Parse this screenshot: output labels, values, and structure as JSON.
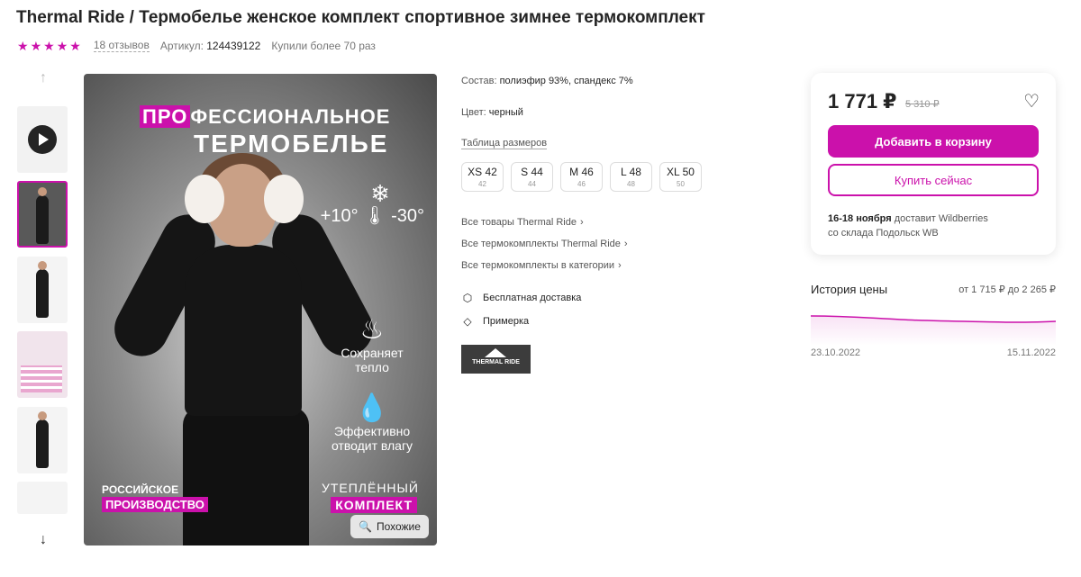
{
  "product": {
    "title": "Thermal Ride / Термобелье женское комплект спортивное зимнее термокомплект",
    "rating_stars": 5,
    "reviews": "18 отзывов",
    "article_label": "Артикул:",
    "article_value": "124439122",
    "bought": "Купили более 70 раз"
  },
  "main_image": {
    "line1_hl": "ПРО",
    "line1_rest": "ФЕССИОНАЛЬНОЕ",
    "line2": "ТЕРМОБЕЛЬЕ",
    "temp": "+10° 🌡 -30°",
    "feature1": "Сохраняет тепло",
    "feature2": "Эффективно отводит влагу",
    "made1": "РОССИЙСКОЕ",
    "made2": "ПРОИЗВОДСТВО",
    "warm1": "УТЕПЛЁННЫЙ",
    "warm2": "КОМПЛЕКТ",
    "similar_label": "Похожие"
  },
  "details": {
    "composition_label": "Состав:",
    "composition_value": "полиэфир 93%, спандекс 7%",
    "color_label": "Цвет:",
    "color_value": "черный",
    "size_table": "Таблица размеров",
    "sizes": [
      {
        "label": "XS 42",
        "ru": "42"
      },
      {
        "label": "S 44",
        "ru": "44"
      },
      {
        "label": "M 46",
        "ru": "46"
      },
      {
        "label": "L 48",
        "ru": "48"
      },
      {
        "label": "XL 50",
        "ru": "50"
      }
    ],
    "links": [
      "Все товары Thermal Ride",
      "Все термокомплекты Thermal Ride",
      "Все термокомплекты в категории"
    ],
    "free_delivery": "Бесплатная доставка",
    "fitting": "Примерка",
    "brand_logo_text": "THERMAL RIDE"
  },
  "card": {
    "price": "1 771 ₽",
    "old_price": "5 310 ₽",
    "add_to_cart": "Добавить в корзину",
    "buy_now": "Купить сейчас",
    "delivery_date": "16-18 ноября",
    "delivery_text": "доставит Wildberries",
    "warehouse": "со склада Подольск WB"
  },
  "price_history": {
    "title": "История цены",
    "range": "от 1 715 ₽ до 2 265 ₽",
    "date_start": "23.10.2022",
    "date_end": "15.11.2022"
  },
  "colors": {
    "accent": "#cb11ab"
  }
}
